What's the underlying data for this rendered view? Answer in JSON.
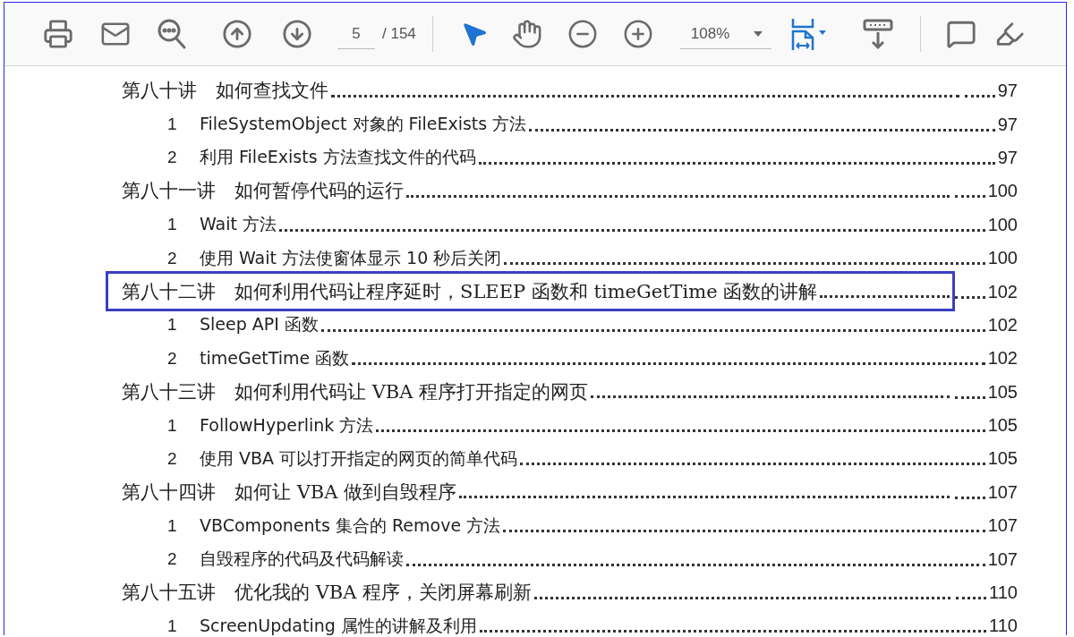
{
  "toolbar": {
    "page_field": "5",
    "page_total": "/ 154",
    "zoom": "108%"
  },
  "toc": [
    {
      "title": "第八十讲　如何查找文件",
      "page": "97",
      "highlighted": false,
      "children": [
        {
          "number": "1",
          "title": "FileSystemObject 对象的 FileExists 方法",
          "page": "97"
        },
        {
          "number": "2",
          "title": "利用 FileExists 方法查找文件的代码",
          "page": "97"
        }
      ]
    },
    {
      "title": "第八十一讲　如何暂停代码的运行",
      "page": "100",
      "highlighted": false,
      "children": [
        {
          "number": "1",
          "title": "Wait 方法",
          "page": "100"
        },
        {
          "number": "2",
          "title": "使用 Wait 方法使窗体显示 10 秒后关闭",
          "page": "100"
        }
      ]
    },
    {
      "title": "第八十二讲　如何利用代码让程序延时，SLEEP 函数和 timeGetTime 函数的讲解",
      "page": "102",
      "highlighted": true,
      "children": [
        {
          "number": "1",
          "title": "Sleep API 函数",
          "page": "102"
        },
        {
          "number": "2",
          "title": "timeGetTime 函数",
          "page": "102"
        }
      ]
    },
    {
      "title": "第八十三讲　如何利用代码让 VBA 程序打开指定的网页",
      "page": "105",
      "highlighted": false,
      "children": [
        {
          "number": "1",
          "title": "FollowHyperlink 方法",
          "page": "105"
        },
        {
          "number": "2",
          "title": "使用 VBA 可以打开指定的网页的简单代码",
          "page": "105"
        }
      ]
    },
    {
      "title": "第八十四讲　如何让 VBA 做到自毁程序",
      "page": "107",
      "highlighted": false,
      "children": [
        {
          "number": "1",
          "title": "VBComponents 集合的 Remove 方法",
          "page": "107"
        },
        {
          "number": "2",
          "title": "自毁程序的代码及代码解读",
          "page": "107"
        }
      ]
    },
    {
      "title": "第八十五讲　优化我的 VBA 程序，关闭屏幕刷新",
      "page": "110",
      "highlighted": false,
      "children": [
        {
          "number": "1",
          "title": "ScreenUpdating 属性的讲解及利用",
          "page": "110"
        }
      ]
    }
  ]
}
